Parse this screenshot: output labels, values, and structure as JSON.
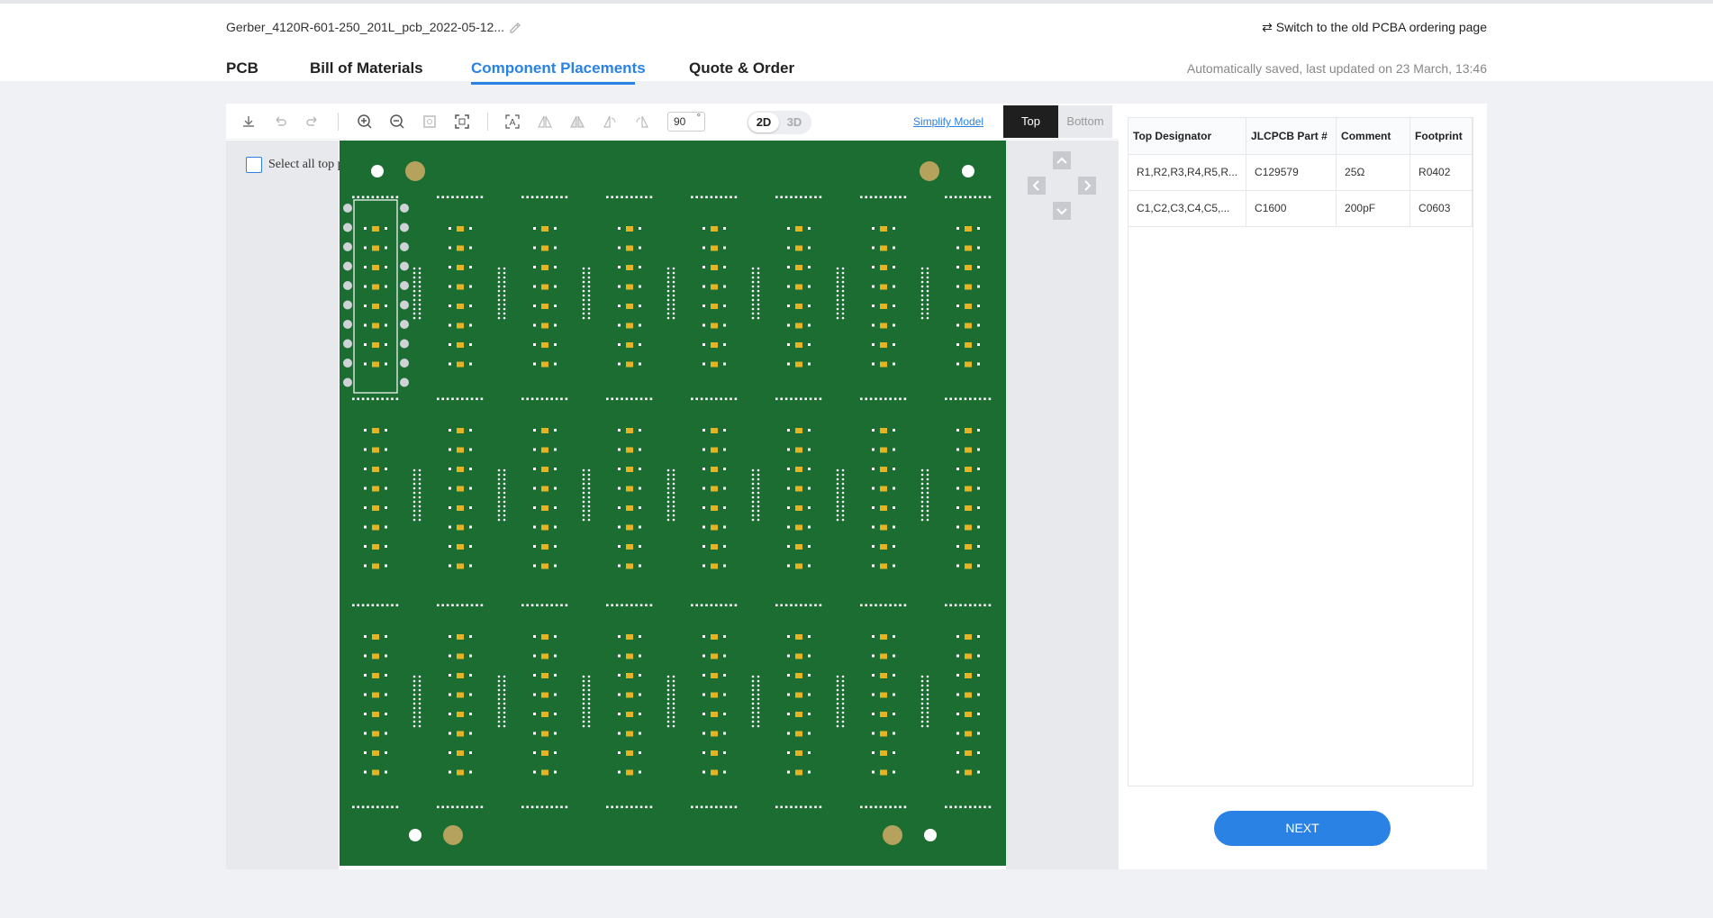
{
  "header": {
    "filename": "Gerber_4120R-601-250_201L_pcb_2022-05-12...",
    "switch_link": "⇄ Switch to the old PCBA ordering page",
    "autosave": "Automatically saved, last updated on 23 March, 13:46"
  },
  "tabs": [
    {
      "label": "PCB"
    },
    {
      "label": "Bill of Materials"
    },
    {
      "label": "Component Placements"
    },
    {
      "label": "Quote & Order"
    }
  ],
  "toolbar": {
    "icons": [
      "download-icon",
      "undo-icon",
      "redo-icon",
      "zoom-in-icon",
      "zoom-out-icon",
      "fit-icon",
      "frame-icon",
      "text-icon",
      "flip-h-icon",
      "flip-v-icon",
      "rotate-left-icon",
      "rotate-right-icon"
    ],
    "angle_value": "90",
    "angle_unit": "°",
    "dim_2d": "2D",
    "dim_3d": "3D",
    "simplify": "Simplify Model",
    "side_top": "Top",
    "side_bottom": "Bottom"
  },
  "left_pane": {
    "select_all": "Select all top parts"
  },
  "table": {
    "headers": [
      "Top Designator",
      "JLCPCB Part #",
      "Comment",
      "Footprint"
    ],
    "rows": [
      [
        "R1,R2,R3,R4,R5,R...",
        "C129579",
        "25Ω",
        "R0402"
      ],
      [
        "C1,C2,C3,C4,C5,...",
        "C1600",
        "200pF",
        "C0603"
      ]
    ]
  },
  "next_button": "NEXT",
  "colors": {
    "accent": "#2a82e4",
    "board_green": "#1b6d32",
    "pad_gold": "#e6b422"
  }
}
